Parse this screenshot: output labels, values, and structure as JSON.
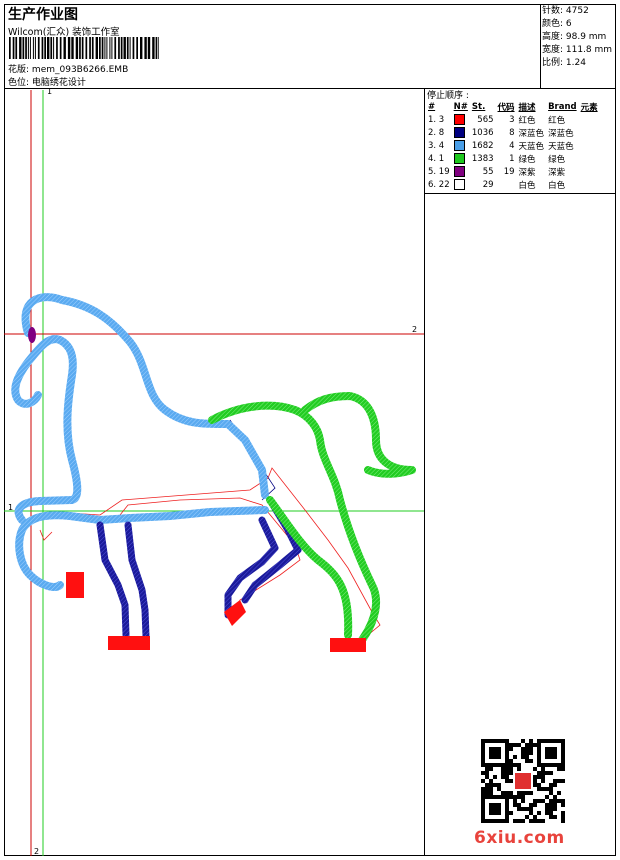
{
  "header": {
    "title": "生产作业图",
    "company": "Wilcom(汇众) 装饰工作室",
    "file_label": "花版:",
    "file_name": "mem_093B6266.EMB",
    "color_label": "色位:",
    "color_value": "电脑绣花设计"
  },
  "stats": {
    "stitches": "针数: 4752",
    "colors": "颜色: 6",
    "height": "高度: 98.9 mm",
    "width": "宽度: 111.8 mm",
    "scale": "比例: 1.24"
  },
  "stop_sequence": {
    "title": "停止顺序 :",
    "columns": [
      "#",
      "N#",
      "St.",
      "代码",
      "描述",
      "Brand",
      "元素"
    ],
    "rows": [
      {
        "idx": "1. 3",
        "color": "#ff0000",
        "st": "565",
        "code": "3",
        "desc": "红色",
        "brand": "红色"
      },
      {
        "idx": "2. 8",
        "color": "#000080",
        "st": "1036",
        "code": "8",
        "desc": "深蓝色",
        "brand": "深蓝色"
      },
      {
        "idx": "3. 4",
        "color": "#4a9fe8",
        "st": "1682",
        "code": "4",
        "desc": "天蓝色",
        "brand": "天蓝色"
      },
      {
        "idx": "4. 1",
        "color": "#1ec81e",
        "st": "1383",
        "code": "1",
        "desc": "绿色",
        "brand": "绿色"
      },
      {
        "idx": "5. 19",
        "color": "#800080",
        "st": "55",
        "code": "19",
        "desc": "深紫",
        "brand": "深紫"
      },
      {
        "idx": "6. 22",
        "color": "#ffffff",
        "st": "29",
        "code": "",
        "desc": "白色",
        "brand": "白色"
      }
    ]
  },
  "axes": {
    "top_marker": "1",
    "right_marker": "2",
    "left_marker": "1",
    "bottom_marker": "2"
  },
  "watermark": "6xiu.com",
  "design_colors": {
    "red": "#ff0000",
    "dark_blue": "#1a1a9a",
    "sky_blue": "#5aaaf0",
    "green": "#22cc22",
    "purple": "#800080"
  }
}
